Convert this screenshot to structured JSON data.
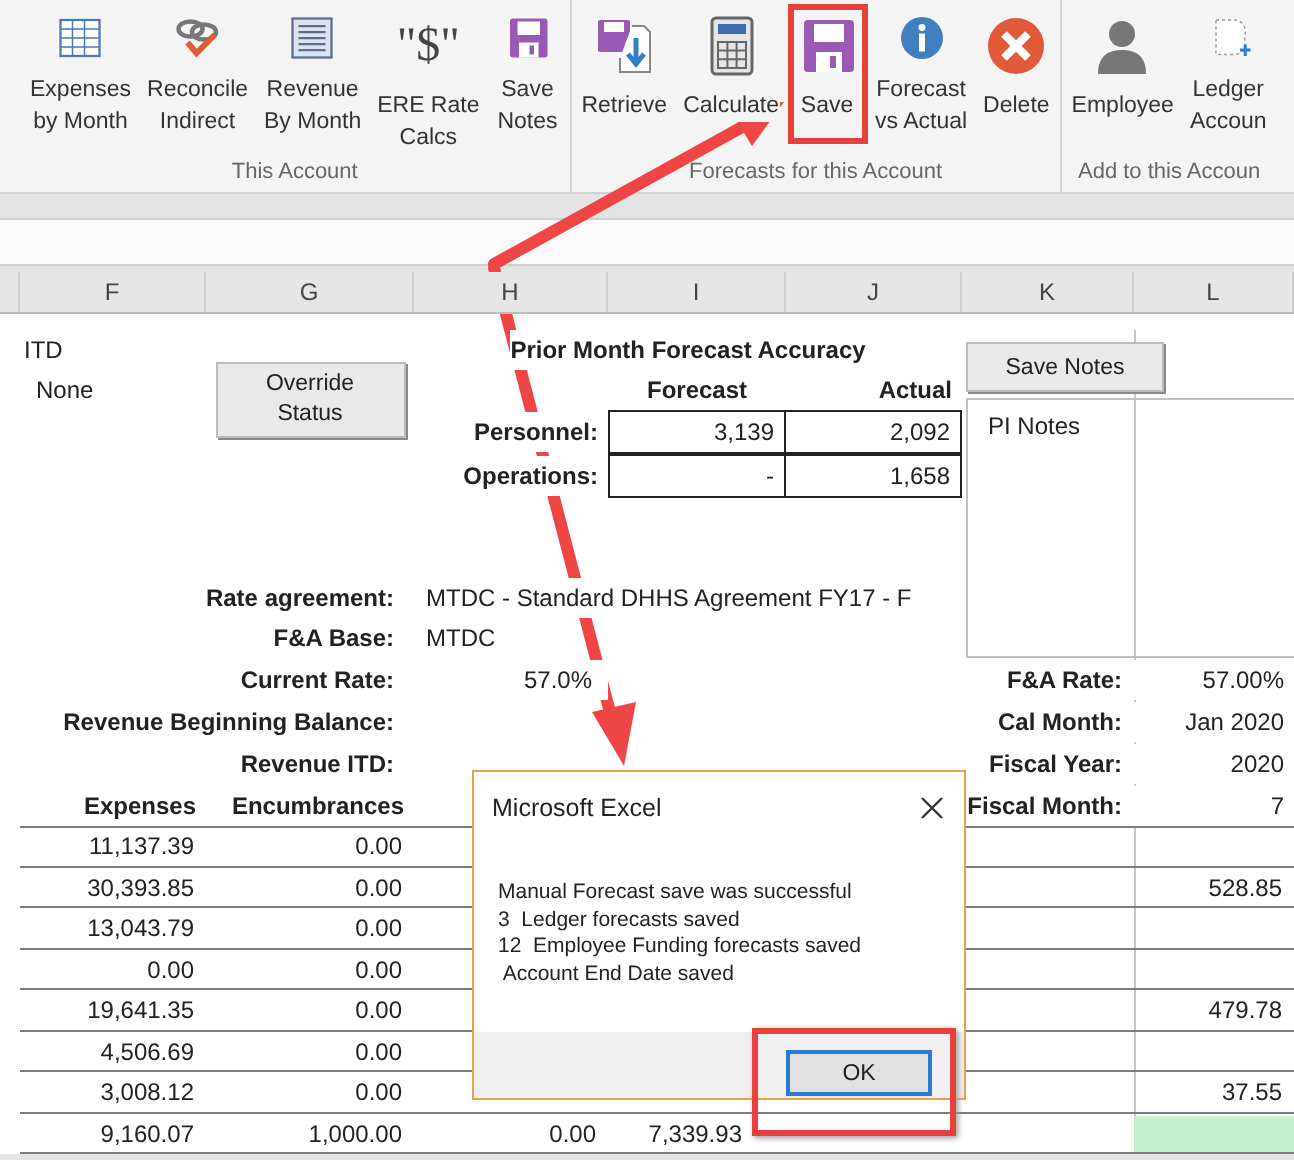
{
  "ribbon": {
    "groups": [
      {
        "label": "This Account",
        "buttons": [
          {
            "lines": [
              "Expenses",
              "by Month"
            ],
            "highlighted": false
          },
          {
            "lines": [
              "Reconcile",
              "Indirect"
            ],
            "highlighted": false
          },
          {
            "lines": [
              "Revenue",
              "By Month"
            ],
            "highlighted": false
          },
          {
            "glyph": "\"$\"",
            "lines": [
              "ERE Rate",
              "Calcs"
            ],
            "highlighted": false
          },
          {
            "lines": [
              "Save",
              "Notes"
            ],
            "highlighted": false
          }
        ]
      },
      {
        "label": "Forecasts for this Account",
        "buttons": [
          {
            "lines": [
              "Retrieve"
            ],
            "highlighted": false
          },
          {
            "lines": [
              "Calculate"
            ],
            "highlighted": false
          },
          {
            "lines": [
              "Save"
            ],
            "highlighted": true
          },
          {
            "lines": [
              "Forecast",
              "vs Actual"
            ],
            "highlighted": false
          },
          {
            "lines": [
              "Delete"
            ],
            "highlighted": false
          }
        ]
      },
      {
        "label": "Add to this Accoun",
        "buttons": [
          {
            "lines": [
              "Employee"
            ],
            "highlighted": false
          },
          {
            "lines": [
              "Ledger",
              "Accoun"
            ],
            "highlighted": false
          }
        ]
      }
    ]
  },
  "columns": [
    "F",
    "G",
    "H",
    "I",
    "J",
    "K",
    "L"
  ],
  "sheet": {
    "itd_label": "ITD",
    "status": "None",
    "override_button": "Override Status",
    "save_notes_button": "Save Notes",
    "pi_notes_label": "PI Notes",
    "accuracy": {
      "title": "Prior Month Forecast Accuracy",
      "headers": [
        "Forecast",
        "Actual"
      ],
      "rows": [
        {
          "label": "Personnel:",
          "forecast": "3,139",
          "actual": "2,092"
        },
        {
          "label": "Operations:",
          "forecast": "-",
          "actual": "1,658"
        }
      ]
    },
    "info_left": [
      {
        "label": "Rate agreement:",
        "value": "MTDC - Standard DHHS Agreement FY17 - F",
        "kind": "text"
      },
      {
        "label": "F&A Base:",
        "value": "MTDC",
        "kind": "text"
      },
      {
        "label": "Current Rate:",
        "value": "57.0%",
        "kind": "number"
      },
      {
        "label": "Revenue Beginning Balance:"
      },
      {
        "label": "Revenue ITD:"
      }
    ],
    "info_right": [
      {
        "label": "F&A Rate:",
        "value": "57.00%"
      },
      {
        "label": "Cal Month:",
        "value": "Jan 2020"
      },
      {
        "label": "Fiscal Year:",
        "value": "2020"
      },
      {
        "label": "Fiscal Month:",
        "value": "7"
      }
    ],
    "table": {
      "columns": [
        "Expenses",
        "Encumbrances"
      ],
      "rows": [
        {
          "expenses": "11,137.39",
          "encumbrances": "0.00",
          "filled": false
        },
        {
          "expenses": "30,393.85",
          "encumbrances": "0.00",
          "column_l": "528.85",
          "filled": false
        },
        {
          "expenses": "13,043.79",
          "encumbrances": "0.00",
          "filled": false
        },
        {
          "expenses": "0.00",
          "encumbrances": "0.00",
          "filled": false
        },
        {
          "expenses": "19,641.35",
          "encumbrances": "0.00",
          "column_l": "479.78",
          "filled": false
        },
        {
          "expenses": "4,506.69",
          "encumbrances": "0.00",
          "filled": false
        },
        {
          "expenses": "3,008.12",
          "encumbrances": "0.00",
          "column_l": "37.55",
          "filled": false
        },
        {
          "expenses": "9,160.07",
          "encumbrances": "1,000.00",
          "column_h": "0.00",
          "column_i": "7,339.93",
          "filled": true
        }
      ]
    }
  },
  "dialog": {
    "title": "Microsoft Excel",
    "lines": [
      "Manual Forecast save was successful",
      "3  Ledger forecasts saved",
      "12  Employee Funding forecasts saved",
      " Account End Date saved"
    ],
    "button": {
      "label": "OK",
      "highlighted": true
    }
  }
}
